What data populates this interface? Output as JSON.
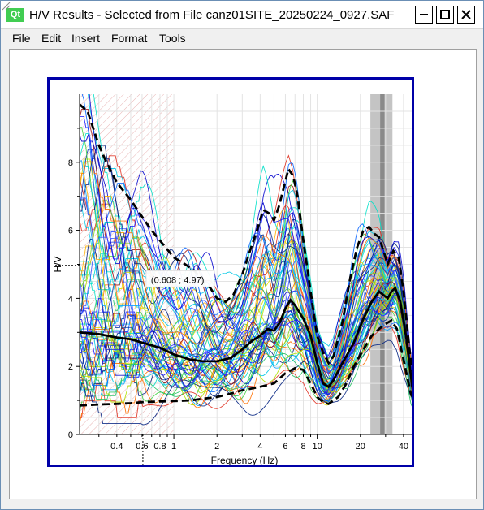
{
  "window": {
    "app_icon": "Qt",
    "title": "H/V Results - Selected from File canz01SITE_20250224_0927.SAF",
    "minimize_icon": "minimize-icon",
    "maximize_icon": "maximize-icon",
    "close_icon": "close-icon"
  },
  "menu": [
    "File",
    "Edit",
    "Insert",
    "Format",
    "Tools"
  ],
  "chart_data": {
    "type": "line",
    "xlabel": "Frequency (Hz)",
    "ylabel": "H/V",
    "x_scale": "log",
    "xlim": [
      0.22,
      50
    ],
    "ylim": [
      0,
      10
    ],
    "x_ticks": [
      {
        "value": 0.4,
        "label": "0.4"
      },
      {
        "value": 0.6,
        "label": "0.6"
      },
      {
        "value": 0.8,
        "label": "0.8"
      },
      {
        "value": 1,
        "label": "1"
      },
      {
        "value": 2,
        "label": "2"
      },
      {
        "value": 4,
        "label": "4"
      },
      {
        "value": 6,
        "label": "6"
      },
      {
        "value": 8,
        "label": "8"
      },
      {
        "value": 10,
        "label": "10"
      },
      {
        "value": 20,
        "label": "20"
      },
      {
        "value": 40,
        "label": "40"
      }
    ],
    "y_ticks": [
      {
        "value": 0,
        "label": "0"
      },
      {
        "value": 2,
        "label": "2"
      },
      {
        "value": 4,
        "label": "4"
      },
      {
        "value": 6,
        "label": "6"
      },
      {
        "value": 8,
        "label": "8"
      }
    ],
    "grid": true,
    "cursor": {
      "x": 0.608,
      "y": 4.97,
      "label": "(0.608 ; 4.97)"
    },
    "hatched_region": [
      0.22,
      1.0
    ],
    "peak_band": {
      "band": [
        23.5,
        33.5
      ],
      "center": [
        27.5,
        29.5
      ]
    },
    "series": [
      {
        "style": "solid",
        "color": "#000000",
        "points": [
          [
            0.22,
            3.0
          ],
          [
            0.3,
            2.95
          ],
          [
            0.4,
            2.85
          ],
          [
            0.5,
            2.8
          ],
          [
            0.6,
            2.7
          ],
          [
            0.8,
            2.55
          ],
          [
            1.0,
            2.35
          ],
          [
            1.3,
            2.2
          ],
          [
            1.6,
            2.15
          ],
          [
            2.0,
            2.15
          ],
          [
            2.5,
            2.25
          ],
          [
            3.0,
            2.5
          ],
          [
            3.5,
            2.75
          ],
          [
            4.0,
            2.9
          ],
          [
            4.5,
            3.1
          ],
          [
            5.0,
            3.05
          ],
          [
            5.5,
            3.3
          ],
          [
            6.0,
            3.7
          ],
          [
            6.5,
            3.95
          ],
          [
            7.0,
            3.8
          ],
          [
            8.0,
            3.4
          ],
          [
            9.0,
            2.9
          ],
          [
            10.0,
            2.1
          ],
          [
            11.0,
            1.5
          ],
          [
            12.0,
            1.4
          ],
          [
            13.0,
            1.6
          ],
          [
            15.0,
            2.1
          ],
          [
            18.0,
            2.7
          ],
          [
            21.0,
            3.4
          ],
          [
            24.0,
            3.9
          ],
          [
            27.0,
            4.2
          ],
          [
            29.0,
            4.1
          ],
          [
            31.0,
            4.0
          ],
          [
            33.0,
            4.2
          ],
          [
            35.0,
            4.3
          ],
          [
            38.0,
            3.9
          ],
          [
            42.0,
            2.8
          ],
          [
            46.0,
            1.4
          ],
          [
            50.0,
            0.9
          ]
        ]
      },
      {
        "style": "dashed",
        "color": "#000000",
        "points": [
          [
            0.22,
            9.7
          ],
          [
            0.25,
            9.5
          ],
          [
            0.3,
            8.5
          ],
          [
            0.33,
            8.1
          ],
          [
            0.4,
            7.4
          ],
          [
            0.5,
            6.9
          ],
          [
            0.6,
            6.4
          ],
          [
            0.7,
            6.0
          ],
          [
            0.8,
            5.7
          ],
          [
            1.0,
            5.2
          ],
          [
            1.2,
            5.0
          ],
          [
            1.4,
            4.8
          ],
          [
            1.6,
            4.5
          ],
          [
            1.8,
            4.3
          ],
          [
            2.0,
            4.0
          ],
          [
            2.3,
            3.9
          ],
          [
            2.6,
            4.1
          ],
          [
            3.0,
            4.7
          ],
          [
            3.4,
            5.4
          ],
          [
            3.8,
            6.0
          ],
          [
            4.2,
            6.6
          ],
          [
            4.6,
            6.5
          ],
          [
            5.0,
            6.3
          ],
          [
            5.4,
            6.7
          ],
          [
            5.8,
            7.2
          ],
          [
            6.3,
            7.8
          ],
          [
            6.8,
            7.6
          ],
          [
            7.3,
            7.0
          ],
          [
            8.0,
            5.7
          ],
          [
            9.0,
            4.2
          ],
          [
            10.0,
            2.9
          ],
          [
            11.0,
            2.4
          ],
          [
            12.0,
            2.1
          ],
          [
            13.0,
            2.3
          ],
          [
            15.0,
            3.3
          ],
          [
            17.0,
            4.6
          ],
          [
            19.0,
            5.5
          ],
          [
            21.0,
            6.0
          ],
          [
            23.0,
            6.1
          ],
          [
            25.0,
            5.9
          ],
          [
            27.0,
            5.8
          ],
          [
            29.0,
            5.4
          ],
          [
            31.0,
            5.0
          ],
          [
            34.0,
            5.4
          ],
          [
            37.0,
            5.2
          ],
          [
            40.0,
            4.2
          ],
          [
            44.0,
            2.5
          ],
          [
            48.0,
            1.4
          ],
          [
            50.0,
            1.2
          ]
        ]
      },
      {
        "style": "dashed",
        "color": "#000000",
        "points": [
          [
            0.22,
            0.85
          ],
          [
            0.3,
            0.88
          ],
          [
            0.4,
            0.9
          ],
          [
            0.5,
            0.92
          ],
          [
            0.6,
            0.95
          ],
          [
            0.8,
            0.97
          ],
          [
            1.0,
            0.98
          ],
          [
            1.3,
            1.0
          ],
          [
            1.6,
            1.05
          ],
          [
            2.0,
            1.1
          ],
          [
            2.5,
            1.2
          ],
          [
            3.0,
            1.3
          ],
          [
            3.5,
            1.35
          ],
          [
            4.0,
            1.4
          ],
          [
            5.0,
            1.5
          ],
          [
            6.0,
            1.8
          ],
          [
            7.0,
            1.95
          ],
          [
            8.0,
            1.9
          ],
          [
            9.0,
            1.5
          ],
          [
            10.0,
            1.1
          ],
          [
            11.0,
            0.95
          ],
          [
            12.0,
            0.9
          ],
          [
            14.0,
            1.1
          ],
          [
            16.0,
            1.5
          ],
          [
            18.0,
            2.0
          ],
          [
            21.0,
            2.5
          ],
          [
            24.0,
            2.9
          ],
          [
            27.0,
            3.1
          ],
          [
            30.0,
            3.25
          ],
          [
            33.0,
            3.35
          ],
          [
            36.0,
            3.1
          ],
          [
            40.0,
            2.2
          ],
          [
            45.0,
            1.2
          ],
          [
            50.0,
            0.8
          ]
        ]
      }
    ]
  }
}
